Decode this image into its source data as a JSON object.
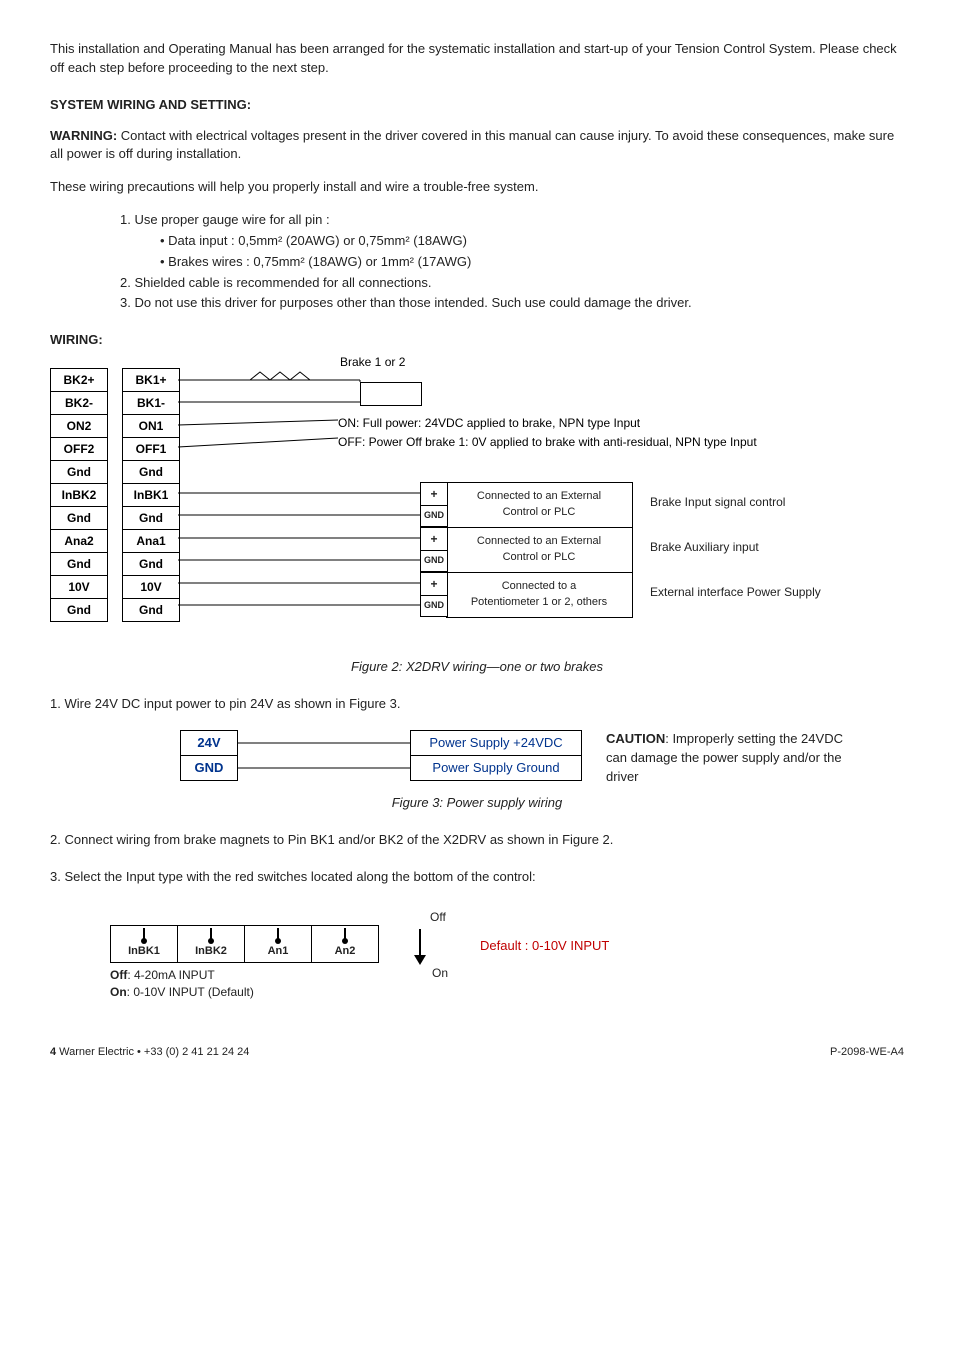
{
  "intro": "This installation and Operating Manual has been arranged for the systematic installation and start-up of your Tension Control System. Please check off each step before proceeding to the next step.",
  "section1": {
    "title": "SYSTEM WIRING AND SETTING:",
    "warning_label": "WARNING:",
    "warning_text": " Contact with electrical voltages present in the driver covered in this manual can cause injury. To avoid these consequences, make sure all power is off during installation.",
    "precautions": "These wiring precautions will help you properly install and wire a trouble-free system.",
    "list": {
      "i1": "1. Use proper gauge wire for all pin :",
      "b1": "• Data input : 0,5mm² (20AWG) or 0,75mm² (18AWG)",
      "b2": "• Brakes wires : 0,75mm² (18AWG) or 1mm² (17AWG)",
      "i2": "2. Shielded cable is recommended for all connections.",
      "i3": "3. Do not use this driver for purposes other than those intended. Such use could damage the driver."
    }
  },
  "wiring_title": "WIRING:",
  "fig2": {
    "left_pins": [
      "BK2+",
      "BK2-",
      "ON2",
      "OFF2",
      "Gnd",
      "InBK2",
      "Gnd",
      "Ana2",
      "Gnd",
      "10V",
      "Gnd"
    ],
    "right_pins": [
      "BK1+",
      "BK1-",
      "ON1",
      "OFF1",
      "Gnd",
      "InBK1",
      "Gnd",
      "Ana1",
      "Gnd",
      "10V",
      "Gnd"
    ],
    "brake_label": "Brake 1 or 2",
    "on_text": "ON: Full power: 24VDC applied to brake, NPN type Input",
    "off_text": "OFF: Power Off brake 1: 0V applied to brake with anti-residual, NPN type Input",
    "rows": [
      {
        "plus": "+",
        "gnd": "GND",
        "mid1": "Connected to an External",
        "mid2": "Control or PLC",
        "note": "Brake Input signal control"
      },
      {
        "plus": "+",
        "gnd": "GND",
        "mid1": "Connected to an External",
        "mid2": "Control or PLC",
        "note": "Brake Auxiliary input"
      },
      {
        "plus": "+",
        "gnd": "GND",
        "mid1": "Connected to a",
        "mid2": "Potentiometer 1 or 2, others",
        "note": "External interface Power Supply"
      }
    ],
    "caption": "Figure 2: X2DRV wiring—one or two brakes"
  },
  "step1": "1. Wire 24V DC input power to pin 24V as shown in Figure 3.",
  "fig3": {
    "left": [
      "24V",
      "GND"
    ],
    "right": [
      "Power Supply +24VDC",
      "Power Supply Ground"
    ],
    "caution_label": "CAUTION",
    "caution_text": ": Improperly setting the 24VDC can damage the power supply and/or the driver",
    "caption": "Figure 3: Power supply wiring"
  },
  "step2": "2. Connect wiring from brake magnets to Pin BK1 and/or BK2 of the X2DRV as shown in Figure 2.",
  "step3": "3. Select the Input type with the red switches located along the bottom of the control:",
  "dip": {
    "switches": [
      "InBK1",
      "InBK2",
      "An1",
      "An2"
    ],
    "off": "Off",
    "on": "On",
    "default": "Default : 0-10V INPUT",
    "off_line_label": "Off",
    "off_line_text": ": 4-20mA INPUT",
    "on_line_label": "On",
    "on_line_text": ": 0-10V INPUT (Default)"
  },
  "footer": {
    "page": "4",
    "left": "  Warner Electric • +33 (0) 2 41 21 24 24",
    "right": "P-2098-WE-A4"
  }
}
